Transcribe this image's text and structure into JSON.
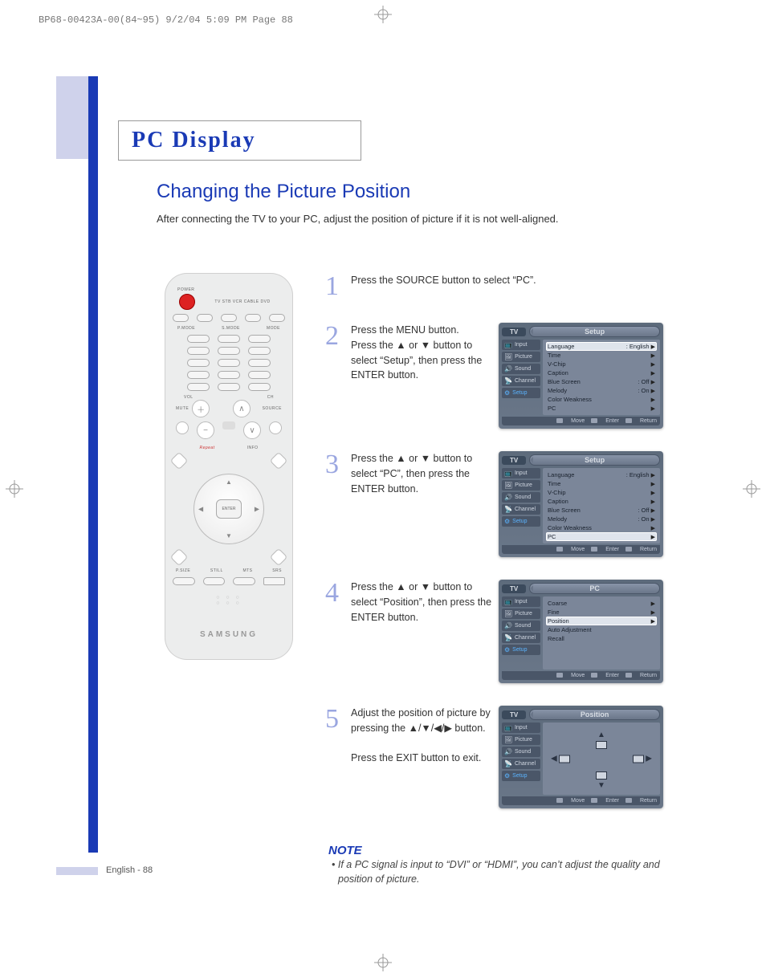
{
  "print_meta": "BP68-00423A-00(84~95)  9/2/04  5:09 PM  Page 88",
  "section_title": "PC Display",
  "h2": "Changing the Picture Position",
  "intro": "After connecting the TV to your PC, adjust the position of picture if it is not well-aligned.",
  "remote": {
    "power_label": "POWER",
    "sources": "TV  STB  VCR  CABLE  DVD",
    "row_labels_1": [
      "P.MODE",
      "S.MODE",
      "MODE"
    ],
    "vol": "VOL",
    "ch": "CH",
    "mute": "MUTE",
    "source": "SOURCE",
    "enter": "ENTER",
    "brand": "SAMSUNG",
    "bottom": [
      "P.SIZE",
      "STILL",
      "MTS",
      "SRS"
    ]
  },
  "steps": [
    {
      "n": "1",
      "text": "Press the SOURCE button to select “PC”.",
      "osd": null
    },
    {
      "n": "2",
      "text": "Press the MENU button.\nPress the ▲ or ▼ button to select “Setup”, then press the ENTER button.",
      "osd": "setup1"
    },
    {
      "n": "3",
      "text": "Press the ▲ or ▼ button to select “PC”, then press the ENTER button.",
      "osd": "setup2"
    },
    {
      "n": "4",
      "text": "Press the ▲ or ▼ button to select “Position”, then press the ENTER button.",
      "osd": "pc"
    },
    {
      "n": "5",
      "text": "Adjust the position of picture by pressing the ▲/▼/◀/▶ button.\n\nPress the EXIT button to exit.",
      "osd": "position"
    }
  ],
  "osd_common": {
    "tv": "TV",
    "side": [
      "Input",
      "Picture",
      "Sound",
      "Channel",
      "Setup"
    ],
    "footer": {
      "move": "Move",
      "enter": "Enter",
      "return": "Return"
    }
  },
  "osd_setup": {
    "title": "Setup",
    "items": [
      {
        "label": "Language",
        "value": ": English"
      },
      {
        "label": "Time",
        "value": ""
      },
      {
        "label": "V-Chip",
        "value": ""
      },
      {
        "label": "Caption",
        "value": ""
      },
      {
        "label": "Blue Screen",
        "value": ": Off"
      },
      {
        "label": "Melody",
        "value": ": On"
      },
      {
        "label": "Color Weakness",
        "value": ""
      },
      {
        "label": "PC",
        "value": ""
      }
    ],
    "highlight1": "Language",
    "highlight2": "PC"
  },
  "osd_pc": {
    "title": "PC",
    "items": [
      {
        "label": "Coarse"
      },
      {
        "label": "Fine"
      },
      {
        "label": "Position"
      },
      {
        "label": "Auto Adjustment"
      },
      {
        "label": "Recall"
      }
    ],
    "highlight": "Position"
  },
  "osd_position": {
    "title": "Position"
  },
  "note": {
    "head": "NOTE",
    "body": "• If a PC signal is input to “DVI” or “HDMI”, you can’t adjust the quality and position of picture."
  },
  "footer": "English - 88"
}
